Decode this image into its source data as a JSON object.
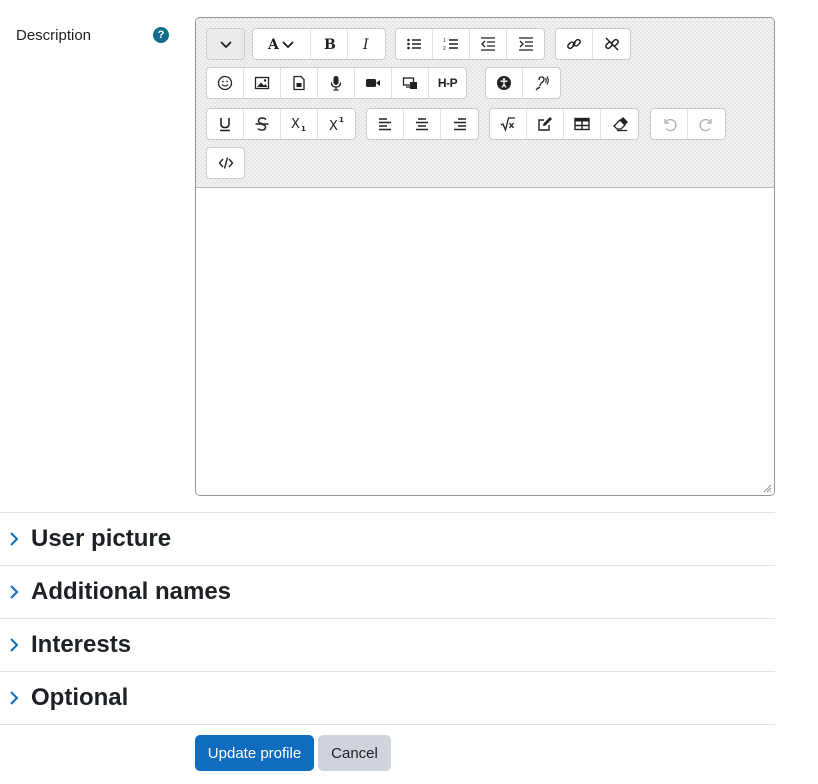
{
  "description_field": {
    "label": "Description",
    "help_icon": "question-circle-icon"
  },
  "toolbar": {
    "row1": [
      {
        "name": "toolbar-toggle",
        "icon": "chevron-down-icon"
      },
      {
        "name": "font-style",
        "icon": "font-icon"
      },
      {
        "name": "bold",
        "icon": "bold-icon"
      },
      {
        "name": "italic",
        "icon": "italic-icon"
      },
      {
        "name": "unordered-list",
        "icon": "list-ul-icon"
      },
      {
        "name": "ordered-list",
        "icon": "list-ol-icon"
      },
      {
        "name": "outdent",
        "icon": "outdent-icon"
      },
      {
        "name": "indent",
        "icon": "indent-icon"
      },
      {
        "name": "link",
        "icon": "link-icon"
      },
      {
        "name": "unlink",
        "icon": "unlink-icon"
      }
    ],
    "row2": [
      {
        "name": "emoji",
        "icon": "smile-icon"
      },
      {
        "name": "image",
        "icon": "image-icon"
      },
      {
        "name": "media",
        "icon": "file-media-icon"
      },
      {
        "name": "record-audio",
        "icon": "microphone-icon"
      },
      {
        "name": "record-video",
        "icon": "video-icon"
      },
      {
        "name": "manage-files",
        "icon": "files-icon"
      },
      {
        "name": "h5p",
        "icon": "h5p-icon",
        "text": "H-P"
      },
      {
        "name": "accessibility-checker",
        "icon": "accessibility-icon"
      },
      {
        "name": "screenreader-helper",
        "icon": "ear-icon"
      }
    ],
    "row3": [
      {
        "name": "underline",
        "icon": "underline-icon"
      },
      {
        "name": "strikethrough",
        "icon": "strikethrough-icon"
      },
      {
        "name": "subscript",
        "icon": "subscript-icon"
      },
      {
        "name": "superscript",
        "icon": "superscript-icon"
      },
      {
        "name": "align-left",
        "icon": "align-left-icon"
      },
      {
        "name": "align-center",
        "icon": "align-center-icon"
      },
      {
        "name": "align-right",
        "icon": "align-right-icon"
      },
      {
        "name": "equation",
        "icon": "sqrt-icon"
      },
      {
        "name": "special-characters",
        "icon": "edit-icon"
      },
      {
        "name": "table",
        "icon": "table-icon"
      },
      {
        "name": "clear-formatting",
        "icon": "eraser-icon"
      },
      {
        "name": "undo",
        "icon": "undo-icon"
      },
      {
        "name": "redo",
        "icon": "redo-icon"
      }
    ],
    "row4": [
      {
        "name": "html-source",
        "icon": "code-icon"
      }
    ]
  },
  "sections": [
    {
      "title": "User picture"
    },
    {
      "title": "Additional names"
    },
    {
      "title": "Interests"
    },
    {
      "title": "Optional"
    }
  ],
  "buttons": {
    "submit": "Update profile",
    "cancel": "Cancel"
  },
  "colors": {
    "primary": "#0f6cbf",
    "secondary": "#ced4da",
    "help": "#0f6e8c"
  }
}
